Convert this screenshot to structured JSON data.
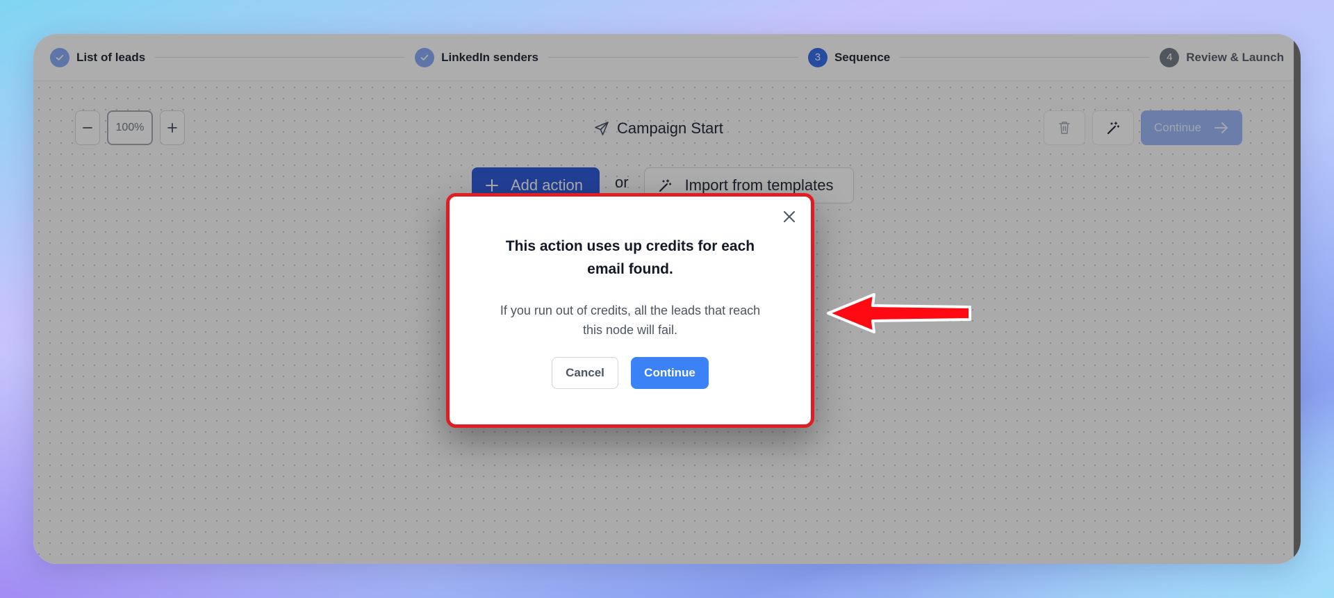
{
  "stepper": {
    "steps": [
      {
        "number": "1",
        "label": "List of leads",
        "state": "done"
      },
      {
        "number": "2",
        "label": "LinkedIn senders",
        "state": "done"
      },
      {
        "number": "3",
        "label": "Sequence",
        "state": "current"
      },
      {
        "number": "4",
        "label": "Review & Launch",
        "state": "upcoming"
      }
    ]
  },
  "toolbar": {
    "zoom_level": "100%",
    "zoom_out_icon": "minus-icon",
    "zoom_in_icon": "plus-icon",
    "continue_label": "Continue"
  },
  "canvas": {
    "start_node_label": "Campaign Start",
    "add_action_label": "Add action",
    "or_label": "or",
    "import_label": "Import from templates"
  },
  "modal": {
    "title": "This action uses up credits for each email found.",
    "body": "If you run out of credits, all the leads that reach this node will fail.",
    "cancel_label": "Cancel",
    "continue_label": "Continue"
  },
  "colors": {
    "primary": "#3b82f6",
    "primary_dark": "#1d4ed8",
    "highlight_border": "#e11d24",
    "annotation_arrow": "#ff0a12"
  }
}
